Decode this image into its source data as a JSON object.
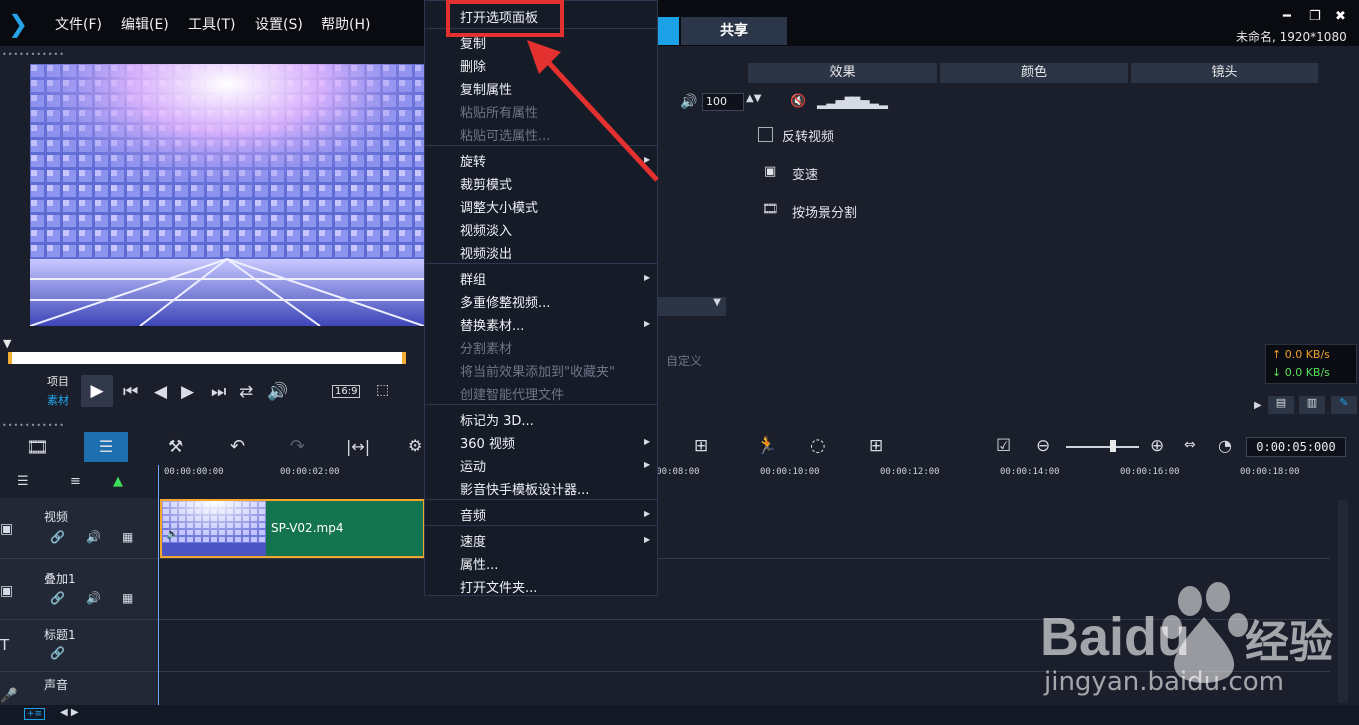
{
  "menubar": {
    "items": [
      "文件(F)",
      "编辑(E)",
      "工具(T)",
      "设置(S)",
      "帮助(H)"
    ],
    "share_tab": "共享",
    "project_info": "未命名, 1920*1080"
  },
  "player": {
    "project_label": "项目",
    "clip_label": "素材",
    "ratio": "16:9"
  },
  "options": {
    "tabs": [
      "效果",
      "颜色",
      "镜头"
    ],
    "volume": "100",
    "reverse_video": "反转视频",
    "speed": "变速",
    "scene_split": "按场景分割",
    "custom": "自定义"
  },
  "speed_meter": {
    "up": "↑ 0.0 KB/s",
    "down": "↓ 0.0 KB/s"
  },
  "timeline": {
    "timecode": "0:00:05:000",
    "ticks": [
      "00:00:00:00",
      "00:00:02:00",
      "00:00:08:00",
      "00:00:10:00",
      "00:00:12:00",
      "00:00:14:00",
      "00:00:16:00",
      "00:00:18:00"
    ],
    "tracks": [
      "视频",
      "叠加1",
      "标题1",
      "声音"
    ],
    "clip_name": "SP-V02.mp4"
  },
  "context_menu": {
    "items": [
      "打开选项面板",
      "复制",
      "删除",
      "复制属性",
      "粘贴所有属性",
      "粘贴可选属性...",
      "旋转",
      "裁剪模式",
      "调整大小模式",
      "视频淡入",
      "视频淡出",
      "群组",
      "多重修整视频...",
      "替换素材...",
      "分割素材",
      "将当前效果添加到\"收藏夹\"",
      "创建智能代理文件",
      "标记为 3D...",
      "360 视频",
      "运动",
      "影音快手模板设计器...",
      "音频",
      "速度",
      "属性...",
      "打开文件夹..."
    ]
  },
  "watermark": {
    "brand": "Baidu",
    "cn": "经验",
    "url": "jingyan.baidu.com"
  },
  "colors": {
    "accent": "#1da1e6",
    "highlight": "#e3312f",
    "clip": "#13744f"
  }
}
